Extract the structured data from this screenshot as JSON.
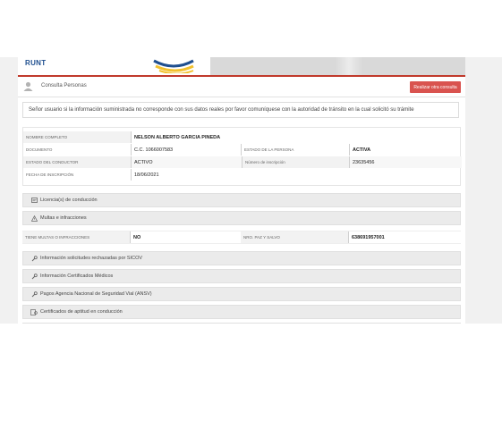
{
  "header": {
    "logo_text": "RUNT"
  },
  "title_bar": {
    "title": "Consulta Personas",
    "action_button": "Realizar otra consulta"
  },
  "notice": "Señor usuario si la información suministrada no corresponde con sus datos reales por favor comuníquese con la autoridad de tránsito en la cual solicitó su trámite",
  "person": {
    "nombre_label": "NOMBRE COMPLETO",
    "nombre_value": "NELSON ALBERTO GARCIA PINEDA",
    "documento_label": "DOCUMENTO",
    "documento_value": "C.C. 1066007583",
    "estado_persona_label": "ESTADO DE LA PERSONA",
    "estado_persona_value": "ACTIVA",
    "estado_conductor_label": "ESTADO DEL CONDUCTOR",
    "estado_conductor_value": "ACTIVO",
    "numero_inscripcion_label": "Número de inscripción",
    "numero_inscripcion_value": "23635456",
    "fecha_inscripcion_label": "FECHA DE INSCRIPCIÓN",
    "fecha_inscripcion_value": "18/06/2021"
  },
  "sections": {
    "licencias": "Licencia(s) de conducción",
    "multas": "Multas e infracciones",
    "sicov": "Información solicitudes rechazadas por SICOV",
    "certificados_medicos": "Información Certificados Médicos",
    "ansv": "Pagos Agencia Nacional de Seguridad Vial (ANSV)",
    "aptitud": "Certificados de aptitud en conducción"
  },
  "fines": {
    "tiene_label": "TIENE MULTAS O INFRACCIONES",
    "tiene_value": "NO",
    "paz_label": "NRO. PAZ Y SALVO",
    "paz_value": "638691957001"
  },
  "colors": {
    "accent_red": "#d9534f",
    "logo_blue": "#1f4f8f",
    "logo_yellow": "#f2c12e"
  }
}
